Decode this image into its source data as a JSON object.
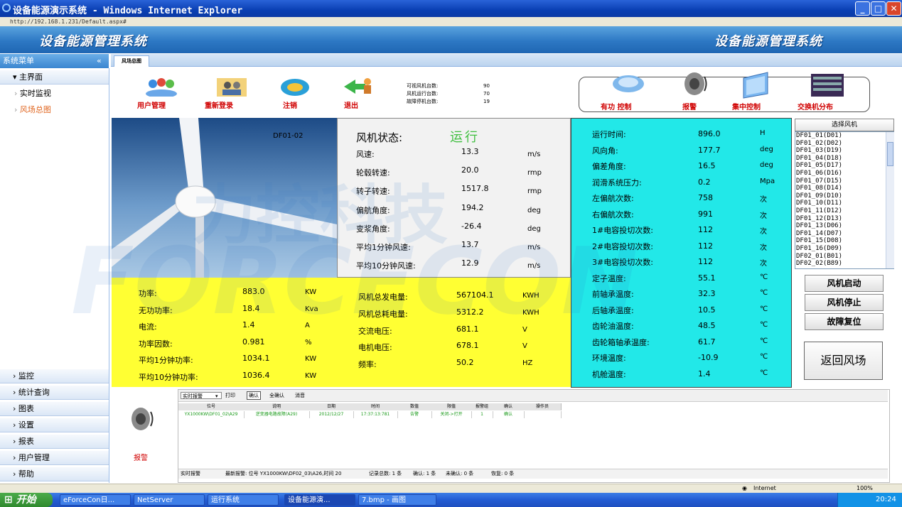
{
  "window": {
    "title": "设备能源演示系统 - Windows Internet Explorer",
    "address": "http://192.168.1.231/Default.aspx#"
  },
  "app": {
    "title_left": "设备能源管理系统",
    "title_right": "设备能源管理系统"
  },
  "sidebar": {
    "header": "系统菜单",
    "collapse_glyph": "«",
    "main_group": "主界面",
    "sub_items": [
      "实时监视",
      "风场总图"
    ],
    "bottom_groups": [
      "监控",
      "统计查询",
      "图表",
      "设置",
      "报表",
      "用户管理",
      "帮助"
    ]
  },
  "tab": {
    "label": "风场总图"
  },
  "toolbar": {
    "buttons": [
      "用户管理",
      "重新登录",
      "注销",
      "退出"
    ],
    "counts": [
      {
        "label": "可视风机台数:",
        "value": "90"
      },
      {
        "label": "风机运行台数:",
        "value": "70"
      },
      {
        "label": "故障停机台数:",
        "value": "19"
      }
    ],
    "right_buttons": [
      "有功 控制",
      "报警",
      "集中控制",
      "交换机分布"
    ]
  },
  "photo": {
    "label": "DF01-02"
  },
  "status": {
    "title": "风机状态:",
    "value": "运行",
    "rows": [
      {
        "label": "风速:",
        "value": "13.3",
        "unit": "m/s"
      },
      {
        "label": "轮毂转速:",
        "value": "20.0",
        "unit": "rmp"
      },
      {
        "label": "转子转速:",
        "value": "1517.8",
        "unit": "rmp"
      },
      {
        "label": "偏航角度:",
        "value": "194.2",
        "unit": "deg"
      },
      {
        "label": "变浆角度:",
        "value": "-26.4",
        "unit": "deg"
      },
      {
        "label": "平均1分钟风速:",
        "value": "13.7",
        "unit": "m/s"
      },
      {
        "label": "平均10分钟风速:",
        "value": "12.9",
        "unit": "m/s"
      }
    ]
  },
  "electric_left": [
    {
      "label": "功率:",
      "value": "883.0",
      "unit": "KW"
    },
    {
      "label": "无功功率:",
      "value": "18.4",
      "unit": "Kva"
    },
    {
      "label": "电流:",
      "value": "1.4",
      "unit": "A"
    },
    {
      "label": "功率因数:",
      "value": "0.981",
      "unit": "%"
    },
    {
      "label": "平均1分钟功率:",
      "value": "1034.1",
      "unit": "KW"
    },
    {
      "label": "平均10分钟功率:",
      "value": "1036.4",
      "unit": "KW"
    }
  ],
  "electric_right": [
    {
      "label": "风机总发电量:",
      "value": "567104.1",
      "unit": "KWH"
    },
    {
      "label": "风机总耗电量:",
      "value": "5312.2",
      "unit": "KWH"
    },
    {
      "label": "交流电压:",
      "value": "681.1",
      "unit": "V"
    },
    {
      "label": "电机电压:",
      "value": "678.1",
      "unit": "V"
    },
    {
      "label": "频率:",
      "value": "50.2",
      "unit": "HZ"
    }
  ],
  "operation": [
    {
      "label": "运行时间:",
      "value": "896.0",
      "unit": "H"
    },
    {
      "label": "风向角:",
      "value": "177.7",
      "unit": "deg"
    },
    {
      "label": "偏差角度:",
      "value": "16.5",
      "unit": "deg"
    },
    {
      "label": "润滑系统压力:",
      "value": "0.2",
      "unit": "Mpa"
    },
    {
      "label": "左偏航次数:",
      "value": "758",
      "unit": "次"
    },
    {
      "label": "右偏航次数:",
      "value": "991",
      "unit": "次"
    },
    {
      "label": "1#电容投切次数:",
      "value": "112",
      "unit": "次"
    },
    {
      "label": "2#电容投切次数:",
      "value": "112",
      "unit": "次"
    },
    {
      "label": "3#电容投切次数:",
      "value": "112",
      "unit": "次"
    },
    {
      "label": "定子温度:",
      "value": "55.1",
      "unit": "℃"
    },
    {
      "label": "前轴承温度:",
      "value": "32.3",
      "unit": "℃"
    },
    {
      "label": "后轴承温度:",
      "value": "10.5",
      "unit": "℃"
    },
    {
      "label": "齿轮油温度:",
      "value": "48.5",
      "unit": "℃"
    },
    {
      "label": "齿轮箱轴承温度:",
      "value": "61.7",
      "unit": "℃"
    },
    {
      "label": "环境温度:",
      "value": "-10.9",
      "unit": "℃"
    },
    {
      "label": "机舱温度:",
      "value": "1.4",
      "unit": "℃"
    }
  ],
  "selector": {
    "title": "选择风机",
    "items": [
      "DF01_01(D01)",
      "DF01_02(D02)",
      "DF01_03(D19)",
      "DF01_04(D18)",
      "DF01_05(D17)",
      "DF01_06(D16)",
      "DF01_07(D15)",
      "DF01_08(D14)",
      "DF01_09(D10)",
      "DF01_10(D11)",
      "DF01_11(D12)",
      "DF01_12(D13)",
      "DF01_13(D06)",
      "DF01_14(D07)",
      "DF01_15(D08)",
      "DF01_16(D09)",
      "DF02_01(B01)",
      "DF02_02(B89)"
    ]
  },
  "controls": {
    "start": "风机启动",
    "stop": "风机停止",
    "reset": "故障复位",
    "back": "返回风场"
  },
  "alarm": {
    "panel_label": "报警",
    "filter_value": "实时报警",
    "buttons": [
      "打印",
      "确认",
      "全确认",
      "消音"
    ],
    "columns": [
      "位号",
      "说明",
      "日期",
      "时间",
      "数值",
      "限值",
      "报警组",
      "确认",
      "操作员"
    ],
    "row": [
      "YX1000KW\\DF01_02\\A29",
      "逆变器电路故障(A29)",
      "2012/12/27",
      "17:37:13:781",
      "告警",
      "关闭->打开",
      "1",
      "确认",
      ""
    ],
    "footer": [
      "实时报警",
      "最新报警: 位号 YX1000KW\\DF02_03\\A26,时间 20",
      "记录总数: 1 条",
      "确认: 1 条",
      "未确认: 0 条",
      "恢复: 0 条"
    ]
  },
  "statusbar": {
    "zone": "Internet",
    "zoom": "100%"
  },
  "taskbar": {
    "start": "开始",
    "items": [
      "eForceCon日...",
      "NetServer",
      "运行系统",
      "设备能源演...",
      "7.bmp - 画图"
    ],
    "clock": "20:24"
  },
  "watermark": {
    "cn": "力控科技",
    "en": "FORCECON"
  }
}
